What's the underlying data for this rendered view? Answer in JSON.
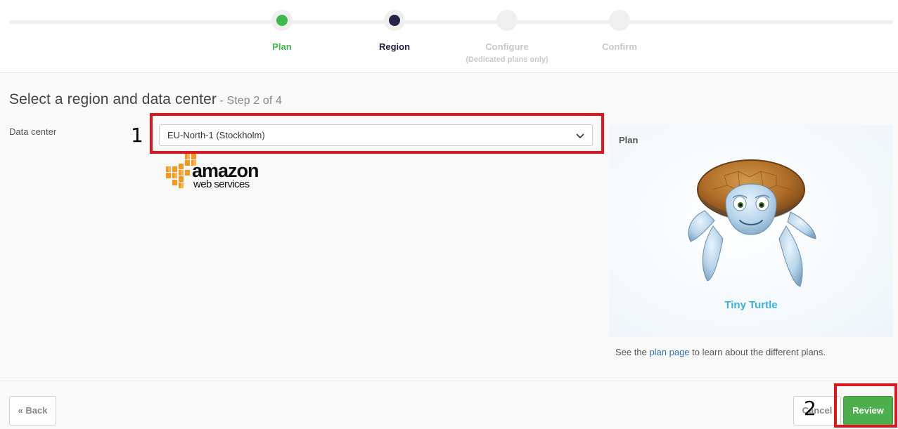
{
  "stepper": {
    "steps": [
      {
        "label": "Plan",
        "sublabel": "",
        "state": "complete",
        "color": "#3dba4e",
        "dot_color": "#3dba4e"
      },
      {
        "label": "Region",
        "sublabel": "",
        "state": "current",
        "color": "#1f1d3d",
        "dot_color": "#25254a"
      },
      {
        "label": "Configure",
        "sublabel": "(Dedicated plans only)",
        "state": "upcoming",
        "color": "#c8c8c8",
        "dot_color": "#efefef"
      },
      {
        "label": "Confirm",
        "sublabel": "",
        "state": "upcoming",
        "color": "#c8c8c8",
        "dot_color": "#efefef"
      }
    ]
  },
  "page": {
    "title": "Select a region and data center",
    "step_count": " - Step 2 of 4"
  },
  "data_center": {
    "label": "Data center",
    "selected": "EU-North-1 (Stockholm)",
    "provider_logo": "amazon-web-services-logo",
    "provider_line1": "amazon",
    "provider_line2": "web services"
  },
  "plan": {
    "heading": "Plan",
    "name": "Tiny Turtle",
    "image": "turtle-mascot",
    "note_before": "See the ",
    "note_link": "plan page",
    "note_after": " to learn about the different plans."
  },
  "annotations": {
    "first": "1",
    "second": "2"
  },
  "footer": {
    "back_label": "« Back",
    "cancel_label": "Cancel",
    "review_label": "Review"
  },
  "colors": {
    "accent_green": "#4cae4c",
    "link_blue": "#2f6fb0",
    "plan_name": "#3ab0e2",
    "annotation_red": "#e0161f",
    "aws_orange": "#f7981d"
  }
}
